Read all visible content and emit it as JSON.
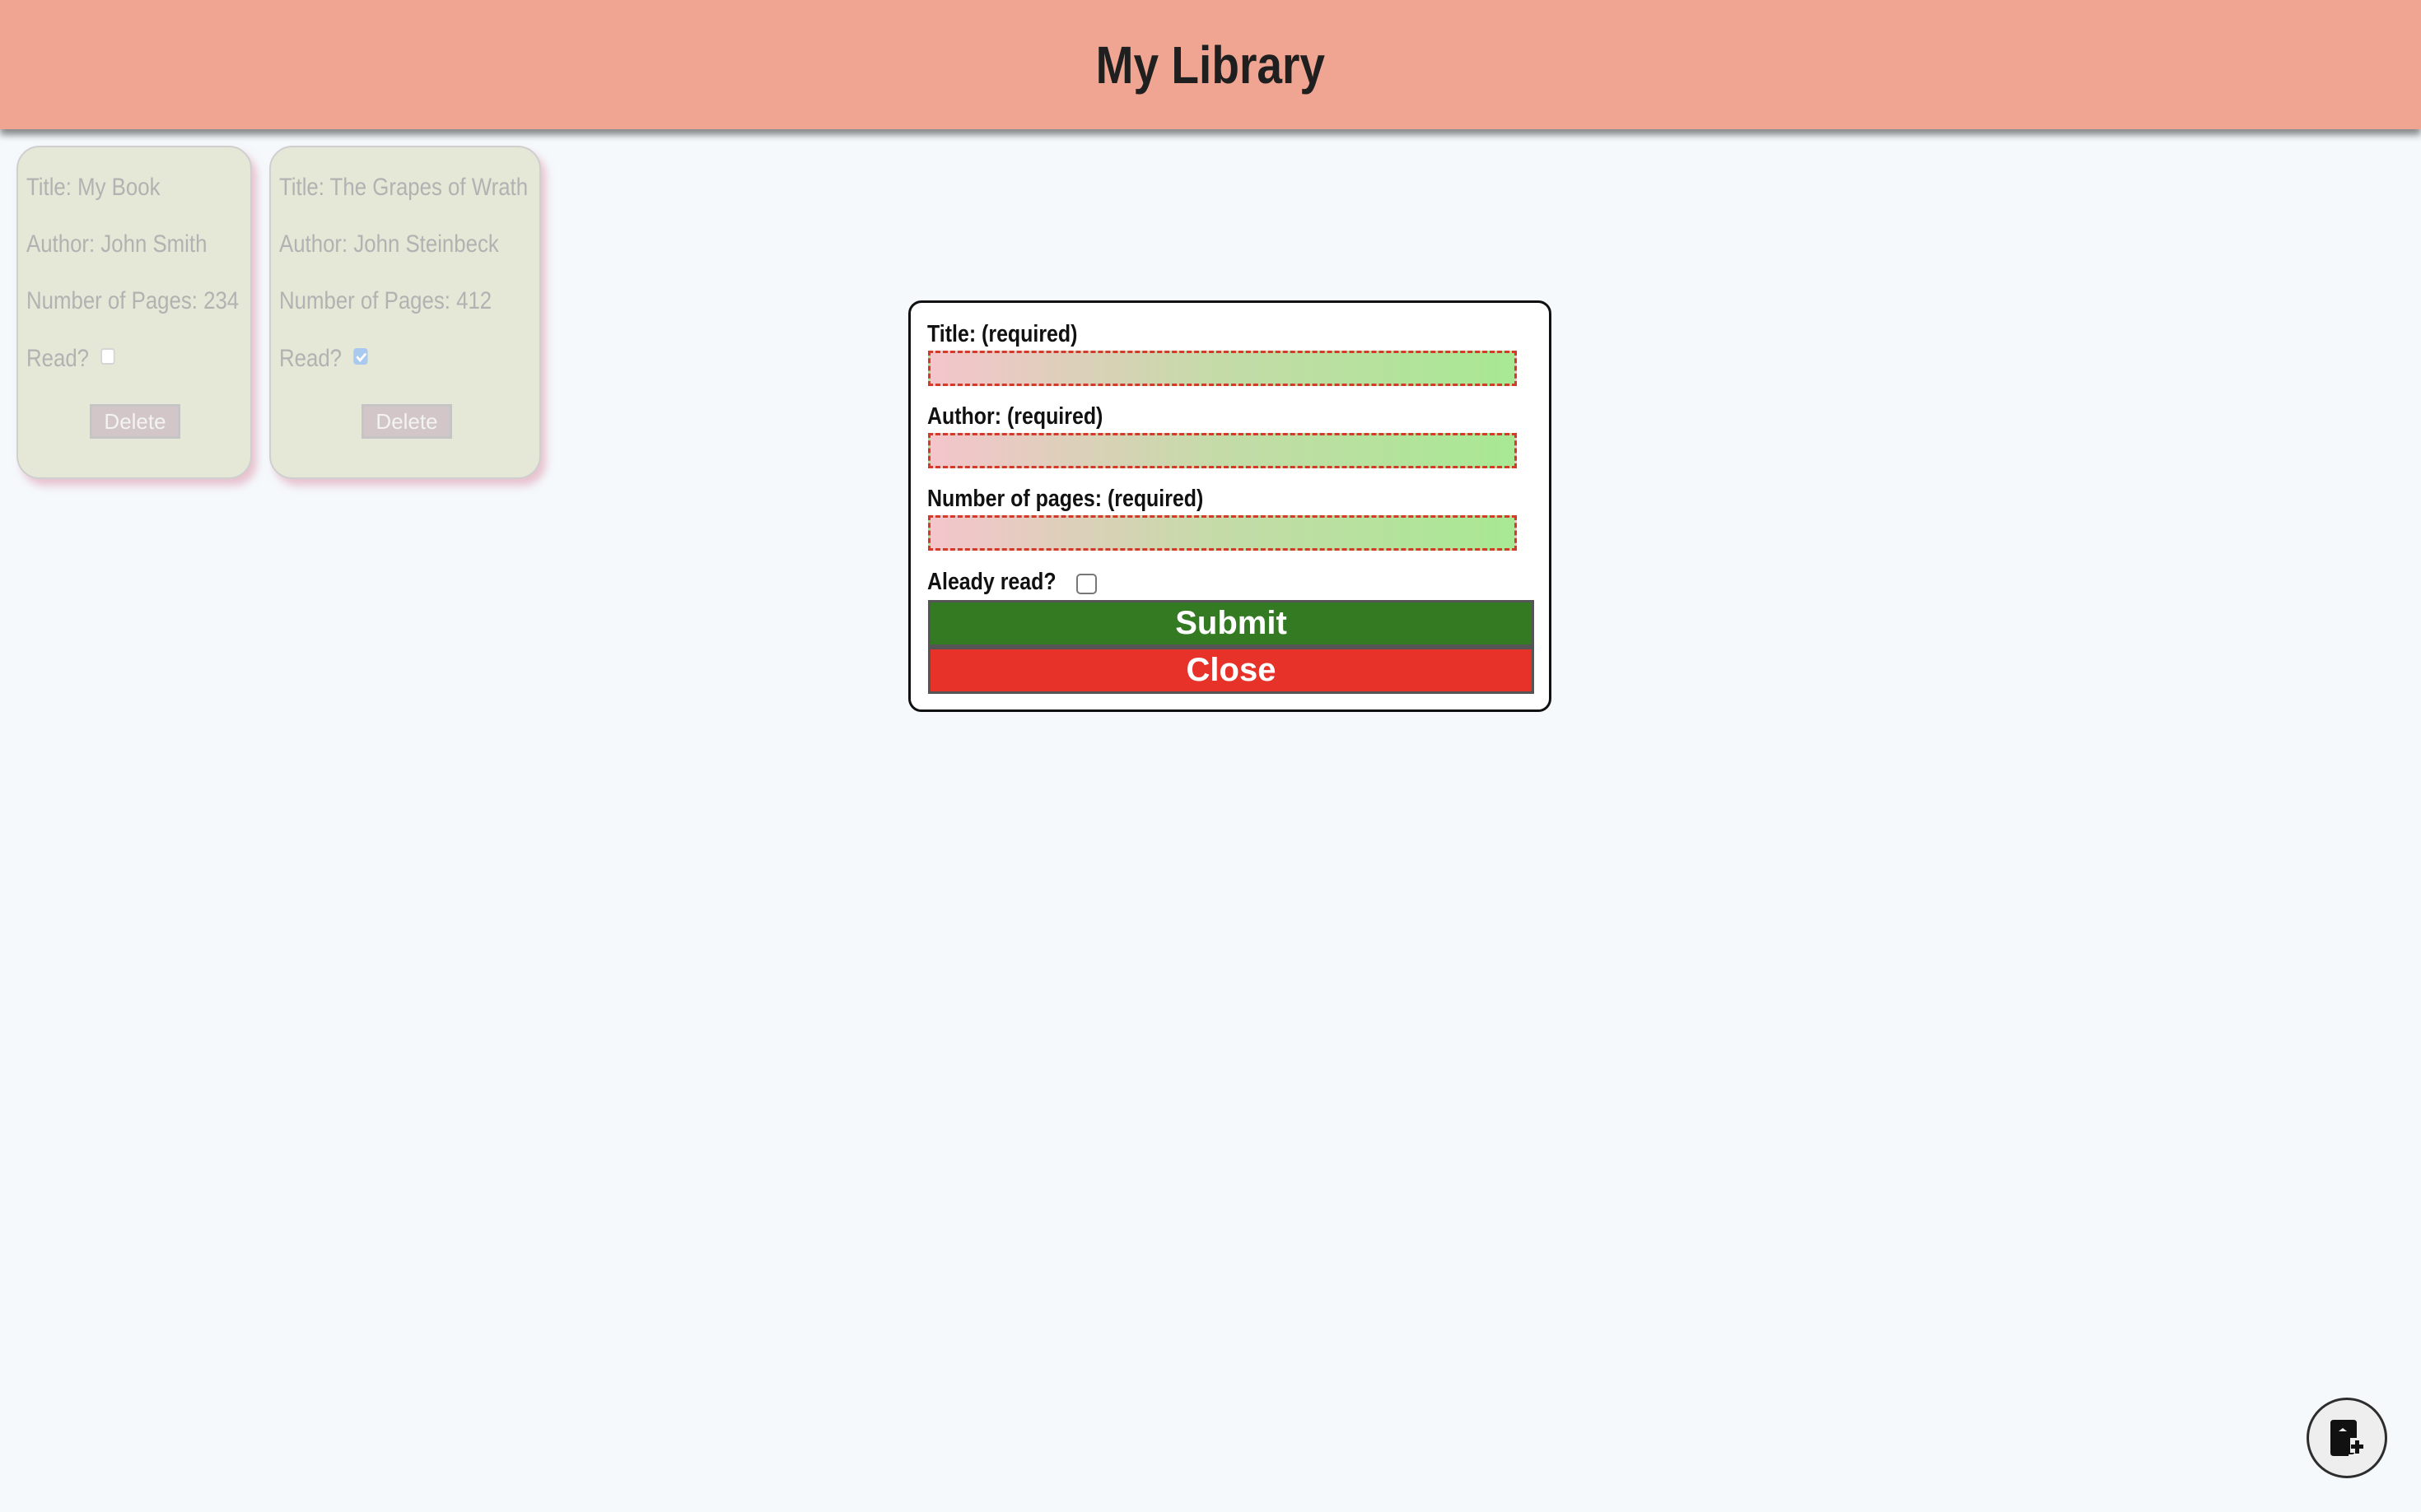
{
  "header": {
    "title": "My Library"
  },
  "books": [
    {
      "title": "Title: My Book",
      "author": "Author: John Smith",
      "pages": "Number of Pages: 234",
      "read_label": "Read?",
      "read": false,
      "delete_label": "Delete"
    },
    {
      "title": "Title: The Grapes of Wrath",
      "author": "Author: John Steinbeck",
      "pages": "Number of Pages: 412",
      "read_label": "Read?",
      "read": true,
      "delete_label": "Delete"
    }
  ],
  "form": {
    "title_label": "Title: (required)",
    "title_value": "",
    "author_label": "Author: (required)",
    "author_value": "",
    "pages_label": "Number of pages: (required)",
    "pages_value": "",
    "read_label": "Aleady read?",
    "read_checked": false,
    "submit_label": "Submit",
    "close_label": "Close"
  },
  "add_book_button": {
    "icon": "add-book-icon"
  },
  "colors": {
    "header_bg": "#efa592",
    "page_bg": "#f5f9fc",
    "card_bg": "#e5e7d7",
    "submit_bg": "#337a22",
    "close_bg": "#e63228",
    "invalid_border": "#d33a2a"
  }
}
